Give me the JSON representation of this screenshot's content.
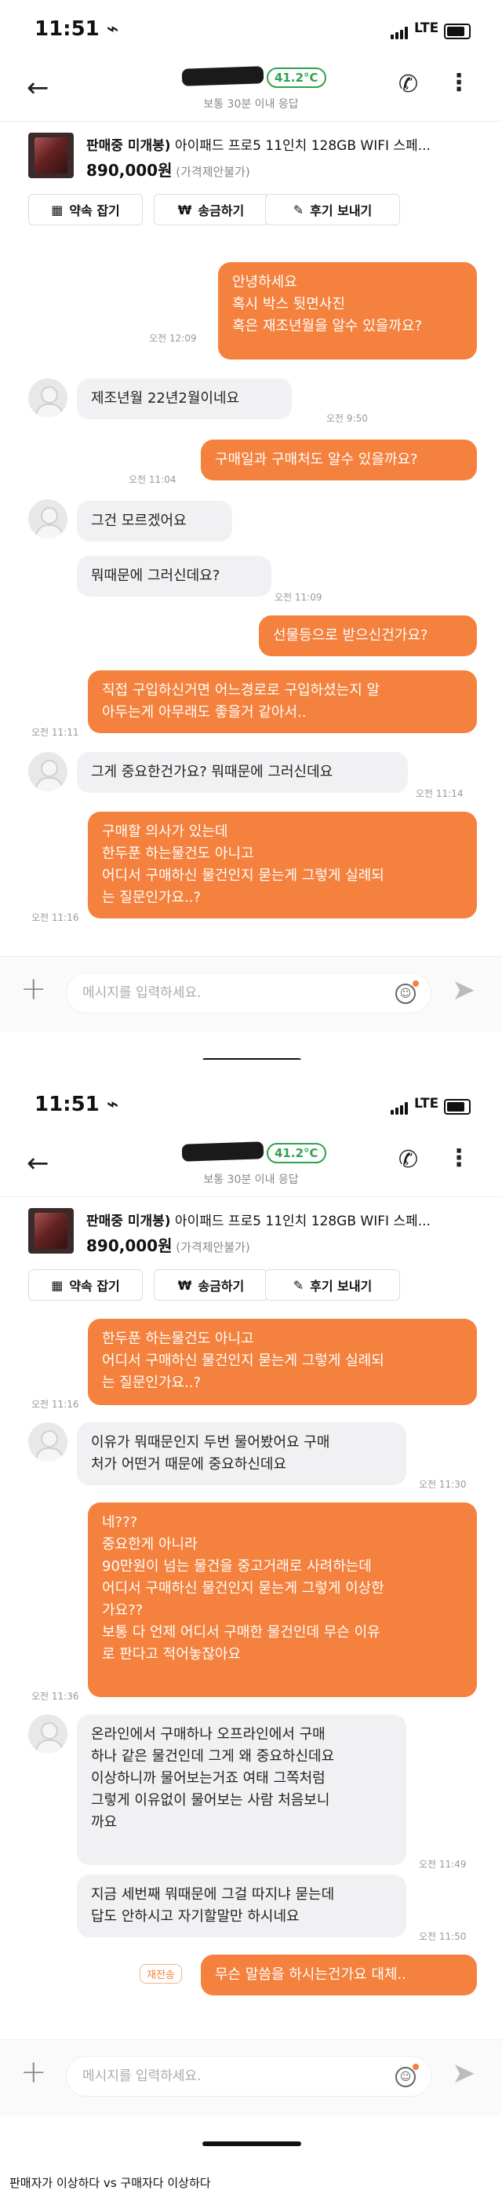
{
  "caption": "판매자가 이상하다 vs 구매자다 이상하다",
  "screens": [
    {
      "status": {
        "time": "11:51 ⌁",
        "network": "LTE"
      },
      "header": {
        "temperature": "41.2°C",
        "response": "보통 30분 이내 응답",
        "back_icon": "back-arrow-icon",
        "phone_icon": "phone-icon",
        "more_icon": "more-vertical-icon"
      },
      "product": {
        "status": "판매중 미개봉)",
        "title": " 아이패드 프로5 11인치 128GB WIFI 스페...",
        "price": "890,000원",
        "price_note": " (가격제안불가)"
      },
      "actions": {
        "appointment": "약속 잡기",
        "send_money": "송금하기",
        "review": "후기 보내기"
      },
      "messages": [
        {
          "dir": "out",
          "text": "안녕하세요\n혹시 박스 뒷면사진\n혹은 재조년월을 알수 있을까요?",
          "time": "오전 12:09"
        },
        {
          "dir": "in",
          "text": "제조년월 22년2월이네요",
          "time": "오전 9:50"
        },
        {
          "dir": "out",
          "text": "구매일과 구매처도 알수 있을까요?",
          "time": "오전 11:04"
        },
        {
          "dir": "in",
          "text": "그건 모르겠어요",
          "time": ""
        },
        {
          "dir": "in",
          "text": "뭐때문에 그러신데요?",
          "time": "오전 11:09"
        },
        {
          "dir": "out",
          "text": "선물등으로 받으신건가요?",
          "time": ""
        },
        {
          "dir": "out",
          "text": "직접 구입하신거면 어느경로로 구입하셨는지 알\n아두는게 아무래도 좋을거 같아서..",
          "time": "오전 11:11"
        },
        {
          "dir": "in",
          "text": "그게 중요한건가요? 뭐때문에 그러신데요",
          "time": "오전 11:14"
        },
        {
          "dir": "out",
          "text": "구매할 의사가 있는데\n한두푼 하는물건도 아니고\n어디서 구매하신 물건인지 묻는게 그렇게 실례되\n는 질문인가요..?",
          "time": "오전 11:16"
        }
      ],
      "input_placeholder": "메시지를 입력하세요."
    },
    {
      "status": {
        "time": "11:51 ⌁",
        "network": "LTE"
      },
      "header": {
        "temperature": "41.2°C",
        "response": "보통 30분 이내 응답"
      },
      "product": {
        "status": "판매중 미개봉)",
        "title": " 아이패드 프로5 11인치 128GB WIFI 스페...",
        "price": "890,000원",
        "price_note": " (가격제안불가)"
      },
      "actions": {
        "appointment": "약속 잡기",
        "send_money": "송금하기",
        "review": "후기 보내기"
      },
      "messages": [
        {
          "dir": "out",
          "text": "한두푼 하는물건도 아니고\n어디서 구매하신 물건인지 묻는게 그렇게 실례되\n는 질문인가요..?",
          "time": "오전 11:16"
        },
        {
          "dir": "in",
          "text": "이유가 뭐때문인지 두번 물어봤어요 구매\n처가 어떤거 때문에 중요하신데요",
          "time": "오전 11:30"
        },
        {
          "dir": "out",
          "text": "네???\n중요한게 아니라\n90만원이 넘는 물건을 중고거래로 사려하는데\n어디서 구매하신 물건인지 묻는게 그렇게 이상한\n가요??\n보통 다 언제 어디서 구매한 물건인데 무슨 이유\n로 판다고 적어놓잖아요",
          "time": "오전 11:36"
        },
        {
          "dir": "in",
          "text": "온라인에서 구매하나 오프라인에서 구매\n하나 같은 물건인데 그게 왜 중요하신데요\n이상하니까 물어보는거죠 여태 그쪽처럼\n그렇게 이유없이 물어보는 사람 처음보니\n까요",
          "time": "오전 11:49"
        },
        {
          "dir": "in",
          "text": "지금 세번째 뭐때문에 그걸 따지냐 묻는데\n답도 안하시고 자기할말만 하시네요",
          "time": "오전 11:50"
        },
        {
          "dir": "out",
          "text": "무슨 말씀을 하시는건가요 대체..",
          "time": "",
          "resend": "재전송"
        }
      ],
      "input_placeholder": "메시지를 입력하세요."
    }
  ]
}
